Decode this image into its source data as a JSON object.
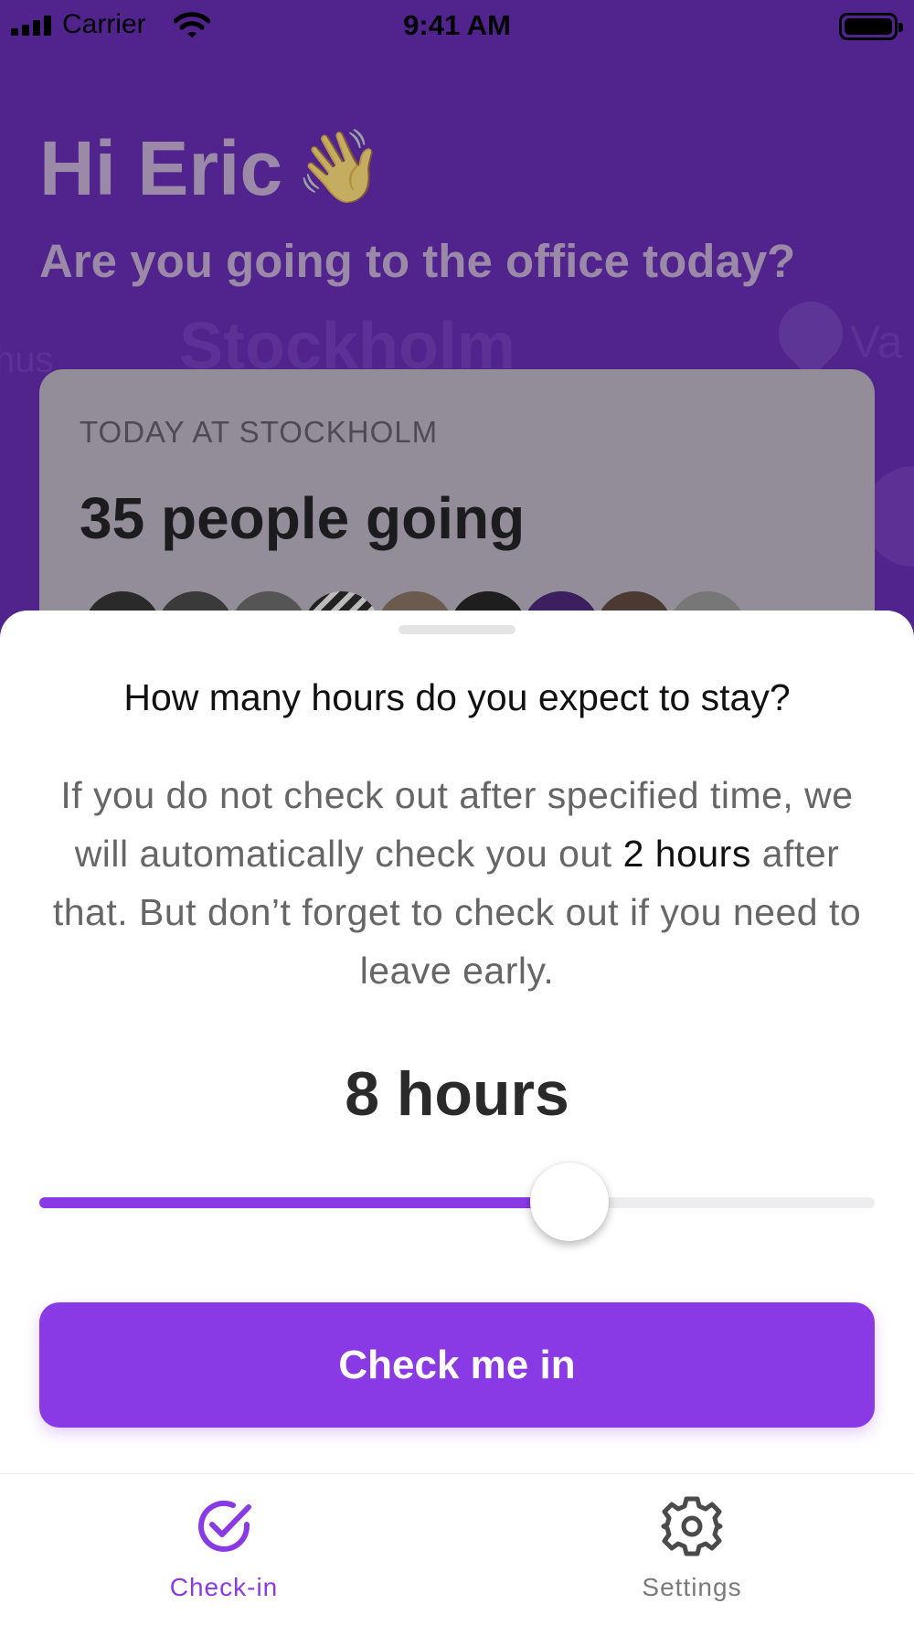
{
  "status_bar": {
    "carrier": "Carrier",
    "time": "9:41 AM"
  },
  "background": {
    "greeting": "Hi Eric",
    "greeting_emoji": "👋",
    "question": "Are you going to the office today?",
    "ghost_city": "Stockholm",
    "ghost_left": "hus",
    "ghost_right": "Va",
    "card": {
      "label": "TODAY AT STOCKHOLM",
      "count": "35 people going"
    }
  },
  "sheet": {
    "title": "How many hours do you expect to stay?",
    "description_before": "If you do not check out after specified time, we will automatically check you out ",
    "description_emphasis": "2 hours",
    "description_after": " after that. But don’t forget to check out if you need to leave early.",
    "hours_display": "8 hours",
    "slider_fraction": 0.635,
    "button_label": "Check me in"
  },
  "tabbar": {
    "checkin_label": "Check-in",
    "settings_label": "Settings",
    "checkin_icon": "check-circle-icon",
    "settings_icon": "gear-icon"
  },
  "colors": {
    "accent": "#8a3ae4",
    "header_bg": "#51238c",
    "tab_inactive": "#7a7a7a"
  }
}
